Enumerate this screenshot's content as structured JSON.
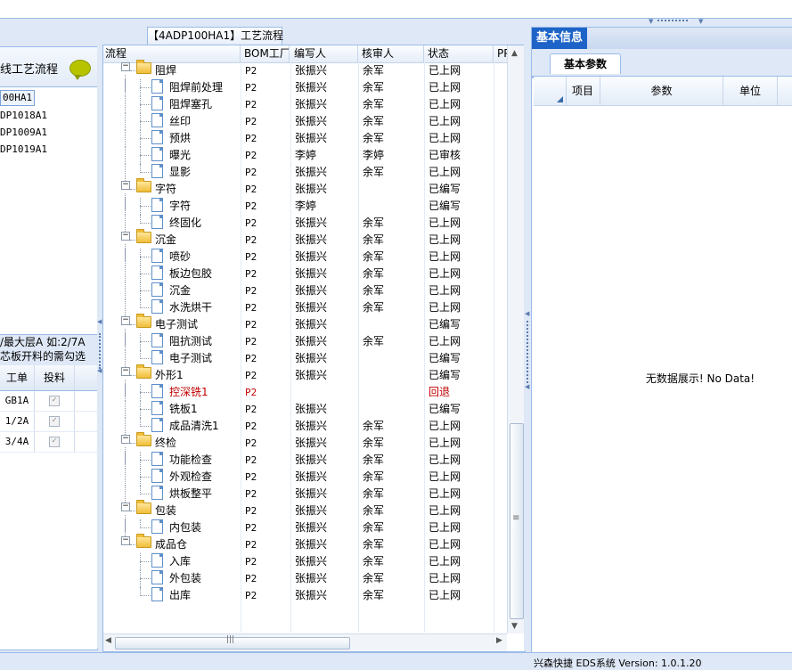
{
  "left_panel": {
    "title": "线工艺流程",
    "items": [
      {
        "label": "00HA1",
        "selected": true
      },
      {
        "label": "DP1018A1",
        "selected": false
      },
      {
        "label": "DP1009A1",
        "selected": false
      },
      {
        "label": "DP1019A1",
        "selected": false
      }
    ],
    "note_line1": "/最大层A 如:2/7A",
    "note_line2": "芯板开料的需勾选",
    "grid_headers": [
      "工单",
      "投料"
    ],
    "grid_rows": [
      {
        "order": "GB1A",
        "checked": true
      },
      {
        "order": "1/2A",
        "checked": true
      },
      {
        "order": "3/4A",
        "checked": true
      }
    ]
  },
  "middle_panel": {
    "tab_title": "【4ADP100HA1】工艺流程",
    "headers": {
      "name": "流程",
      "bom": "BOM工厂",
      "writer": "编写人",
      "reviewer": "核审人",
      "status": "状态",
      "pp": "PP"
    },
    "rows": [
      {
        "level": 0,
        "type": "folder",
        "name": "阻焊",
        "bom": "P2",
        "writer": "张振兴",
        "reviewer": "余军",
        "status": "已上网"
      },
      {
        "level": 1,
        "type": "doc",
        "name": "阻焊前处理",
        "bom": "P2",
        "writer": "张振兴",
        "reviewer": "余军",
        "status": "已上网"
      },
      {
        "level": 1,
        "type": "doc",
        "name": "阻焊塞孔",
        "bom": "P2",
        "writer": "张振兴",
        "reviewer": "余军",
        "status": "已上网"
      },
      {
        "level": 1,
        "type": "doc",
        "name": "丝印",
        "bom": "P2",
        "writer": "张振兴",
        "reviewer": "余军",
        "status": "已上网"
      },
      {
        "level": 1,
        "type": "doc",
        "name": "预烘",
        "bom": "P2",
        "writer": "张振兴",
        "reviewer": "余军",
        "status": "已上网"
      },
      {
        "level": 1,
        "type": "doc",
        "name": "曝光",
        "bom": "P2",
        "writer": "李婷",
        "reviewer": "李婷",
        "status": "已审核"
      },
      {
        "level": 1,
        "type": "doc",
        "name": "显影",
        "bom": "P2",
        "writer": "张振兴",
        "reviewer": "余军",
        "status": "已上网"
      },
      {
        "level": 0,
        "type": "folder",
        "name": "字符",
        "bom": "P2",
        "writer": "张振兴",
        "reviewer": "",
        "status": "已编写"
      },
      {
        "level": 1,
        "type": "doc",
        "name": "字符",
        "bom": "P2",
        "writer": "李婷",
        "reviewer": "",
        "status": "已编写"
      },
      {
        "level": 1,
        "type": "doc",
        "name": "终固化",
        "bom": "P2",
        "writer": "张振兴",
        "reviewer": "余军",
        "status": "已上网"
      },
      {
        "level": 0,
        "type": "folder",
        "name": "沉金",
        "bom": "P2",
        "writer": "张振兴",
        "reviewer": "余军",
        "status": "已上网"
      },
      {
        "level": 1,
        "type": "doc",
        "name": "喷砂",
        "bom": "P2",
        "writer": "张振兴",
        "reviewer": "余军",
        "status": "已上网"
      },
      {
        "level": 1,
        "type": "doc",
        "name": "板边包胶",
        "bom": "P2",
        "writer": "张振兴",
        "reviewer": "余军",
        "status": "已上网"
      },
      {
        "level": 1,
        "type": "doc",
        "name": "沉金",
        "bom": "P2",
        "writer": "张振兴",
        "reviewer": "余军",
        "status": "已上网"
      },
      {
        "level": 1,
        "type": "doc",
        "name": "水洗烘干",
        "bom": "P2",
        "writer": "张振兴",
        "reviewer": "余军",
        "status": "已上网"
      },
      {
        "level": 0,
        "type": "folder",
        "name": "电子测试",
        "bom": "P2",
        "writer": "张振兴",
        "reviewer": "",
        "status": "已编写"
      },
      {
        "level": 1,
        "type": "doc",
        "name": "阻抗测试",
        "bom": "P2",
        "writer": "张振兴",
        "reviewer": "余军",
        "status": "已上网"
      },
      {
        "level": 1,
        "type": "doc",
        "name": "电子测试",
        "bom": "P2",
        "writer": "张振兴",
        "reviewer": "",
        "status": "已编写"
      },
      {
        "level": 0,
        "type": "folder",
        "name": "外形1",
        "bom": "P2",
        "writer": "张振兴",
        "reviewer": "",
        "status": "已编写"
      },
      {
        "level": 1,
        "type": "doc",
        "name": "控深铣1",
        "bom": "P2",
        "writer": "",
        "reviewer": "",
        "status": "回退",
        "highlight": true
      },
      {
        "level": 1,
        "type": "doc",
        "name": "铣板1",
        "bom": "P2",
        "writer": "张振兴",
        "reviewer": "",
        "status": "已编写"
      },
      {
        "level": 1,
        "type": "doc",
        "name": "成品清洗1",
        "bom": "P2",
        "writer": "张振兴",
        "reviewer": "余军",
        "status": "已上网"
      },
      {
        "level": 0,
        "type": "folder",
        "name": "终检",
        "bom": "P2",
        "writer": "张振兴",
        "reviewer": "余军",
        "status": "已上网"
      },
      {
        "level": 1,
        "type": "doc",
        "name": "功能检查",
        "bom": "P2",
        "writer": "张振兴",
        "reviewer": "余军",
        "status": "已上网"
      },
      {
        "level": 1,
        "type": "doc",
        "name": "外观检查",
        "bom": "P2",
        "writer": "张振兴",
        "reviewer": "余军",
        "status": "已上网"
      },
      {
        "level": 1,
        "type": "doc",
        "name": "烘板整平",
        "bom": "P2",
        "writer": "张振兴",
        "reviewer": "余军",
        "status": "已上网"
      },
      {
        "level": 0,
        "type": "folder",
        "name": "包装",
        "bom": "P2",
        "writer": "张振兴",
        "reviewer": "余军",
        "status": "已上网"
      },
      {
        "level": 1,
        "type": "doc",
        "name": "内包装",
        "bom": "P2",
        "writer": "张振兴",
        "reviewer": "余军",
        "status": "已上网"
      },
      {
        "level": 0,
        "type": "folder",
        "name": "成品仓",
        "bom": "P2",
        "writer": "张振兴",
        "reviewer": "余军",
        "status": "已上网"
      },
      {
        "level": 1,
        "type": "doc",
        "name": "入库",
        "bom": "P2",
        "writer": "张振兴",
        "reviewer": "余军",
        "status": "已上网"
      },
      {
        "level": 1,
        "type": "doc",
        "name": "外包装",
        "bom": "P2",
        "writer": "张振兴",
        "reviewer": "余军",
        "status": "已上网"
      },
      {
        "level": 1,
        "type": "doc",
        "name": "出库",
        "bom": "P2",
        "writer": "张振兴",
        "reviewer": "余军",
        "status": "已上网"
      }
    ]
  },
  "right_panel": {
    "title": "基本信息",
    "tab": "基本参数",
    "grid_headers": [
      "项目",
      "参数",
      "单位"
    ],
    "empty_message": "无数据展示! No Data!"
  },
  "statusbar": {
    "text": "兴森快捷 EDS系统 Version: 1.0.1.20"
  },
  "colors": {
    "border": "#99bbe8",
    "panel_bg": "#dfe8f6",
    "title_tab": "#1e64c8",
    "highlight_text": "#c00000"
  }
}
